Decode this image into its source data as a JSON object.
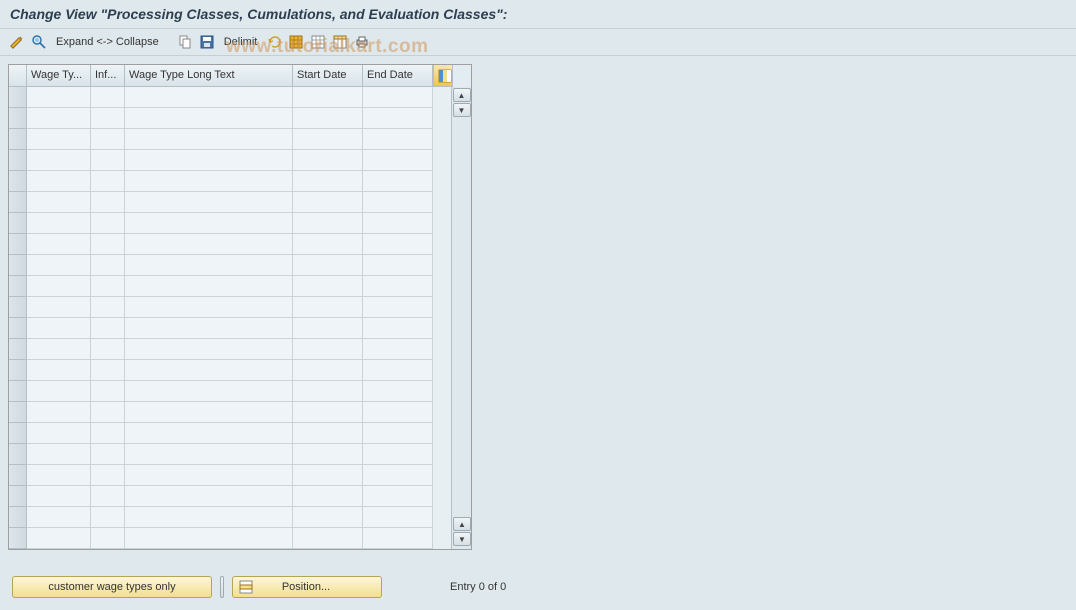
{
  "title": "Change View \"Processing Classes, Cumulations, and Evaluation Classes\":",
  "toolbar": {
    "expand_collapse": "Expand <-> Collapse",
    "delimit": "Delimit"
  },
  "table": {
    "headers": {
      "wage_type": "Wage Ty...",
      "inf": "Inf...",
      "long_text": "Wage Type Long Text",
      "start_date": "Start Date",
      "end_date": "End Date"
    },
    "row_count": 22
  },
  "footer": {
    "customer_btn": "customer wage types only",
    "position_btn": "Position...",
    "entry_text": "Entry 0 of 0"
  },
  "watermark": "www.tutorialkart.com"
}
